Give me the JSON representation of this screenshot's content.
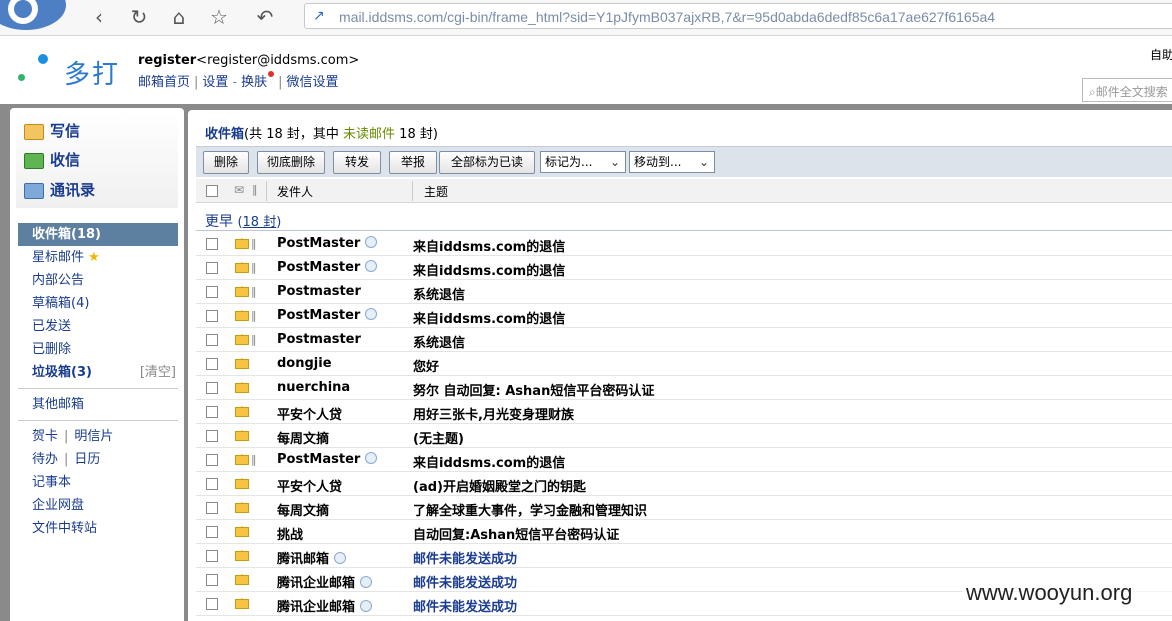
{
  "browser": {
    "url": "mail.iddsms.com/cgi-bin/frame_html?sid=Y1pJfymB037ajxRB,7&r=95d0abda6dedf85c6a17ae627f6165a4"
  },
  "header": {
    "brand": "多打",
    "username": "register",
    "email": "<register@iddsms.com>",
    "links": [
      "邮箱首页",
      "设置",
      "换肤",
      "微信设置"
    ],
    "top_right": "自助",
    "search_placeholder": "邮件全文搜索"
  },
  "quick": {
    "compose": "写信",
    "receive": "收信",
    "contacts": "通讯录"
  },
  "folders": {
    "inbox": "收件箱(18)",
    "starred": "星标邮件",
    "notice": "内部公告",
    "drafts": "草稿箱(4)",
    "sent": "已发送",
    "deleted": "已删除",
    "spam": "垃圾箱(3)",
    "clear": "[清空]",
    "other": "其他邮箱",
    "greeting": "贺卡",
    "postcard": "明信片",
    "todo": "待办",
    "calendar": "日历",
    "notes": "记事本",
    "disk": "企业网盘",
    "transfer": "文件中转站"
  },
  "inbox": {
    "title": "收件箱",
    "summary_prefix": "(共 18 封，其中 ",
    "unread_label": "未读邮件",
    "summary_suffix": " 18 封)"
  },
  "toolbar": {
    "delete": "删除",
    "purge": "彻底删除",
    "forward": "转发",
    "report": "举报",
    "mark_all_read": "全部标为已读",
    "mark_as": "标记为...",
    "move_to": "移动到..."
  },
  "columns": {
    "sender": "发件人",
    "subject": "主题"
  },
  "group": {
    "label": "更早",
    "count": "18 封"
  },
  "mails": [
    {
      "sender": "PostMaster",
      "subject": "来自iddsms.com的退信",
      "attach": true,
      "vip": true,
      "blue": false
    },
    {
      "sender": "PostMaster",
      "subject": "来自iddsms.com的退信",
      "attach": true,
      "vip": true,
      "blue": false
    },
    {
      "sender": "Postmaster",
      "subject": "系统退信",
      "attach": true,
      "vip": false,
      "blue": false
    },
    {
      "sender": "PostMaster",
      "subject": "来自iddsms.com的退信",
      "attach": true,
      "vip": true,
      "blue": false
    },
    {
      "sender": "Postmaster",
      "subject": "系统退信",
      "attach": true,
      "vip": false,
      "blue": false
    },
    {
      "sender": "dongjie",
      "subject": "您好",
      "attach": false,
      "vip": false,
      "blue": false
    },
    {
      "sender": "nuerchina",
      "subject": "努尔 自动回复: Ashan短信平台密码认证",
      "attach": false,
      "vip": false,
      "blue": false
    },
    {
      "sender": "平安个人贷",
      "subject": "用好三张卡,月光变身理财族",
      "attach": false,
      "vip": false,
      "blue": false
    },
    {
      "sender": "每周文摘",
      "subject": "(无主题)",
      "attach": false,
      "vip": false,
      "blue": false
    },
    {
      "sender": "PostMaster",
      "subject": "来自iddsms.com的退信",
      "attach": true,
      "vip": true,
      "blue": false
    },
    {
      "sender": "平安个人贷",
      "subject": "(ad)开启婚姻殿堂之门的钥匙",
      "attach": false,
      "vip": false,
      "blue": false
    },
    {
      "sender": "每周文摘",
      "subject": "了解全球重大事件，学习金融和管理知识",
      "attach": false,
      "vip": false,
      "blue": false
    },
    {
      "sender": "挑战",
      "subject": "自动回复:Ashan短信平台密码认证",
      "attach": false,
      "vip": false,
      "blue": false
    },
    {
      "sender": " 腾讯邮箱",
      "subject": "邮件未能发送成功",
      "attach": false,
      "vip": true,
      "blue": true
    },
    {
      "sender": "腾讯企业邮箱",
      "subject": "邮件未能发送成功",
      "attach": false,
      "vip": true,
      "blue": true
    },
    {
      "sender": "腾讯企业邮箱",
      "subject": "邮件未能发送成功",
      "attach": false,
      "vip": true,
      "blue": true
    }
  ],
  "watermark": "www.wooyun.org",
  "colors": {
    "accent": "#1a3c8e",
    "active_folder": "#5d7fa0",
    "unread": "#6a8a00"
  }
}
